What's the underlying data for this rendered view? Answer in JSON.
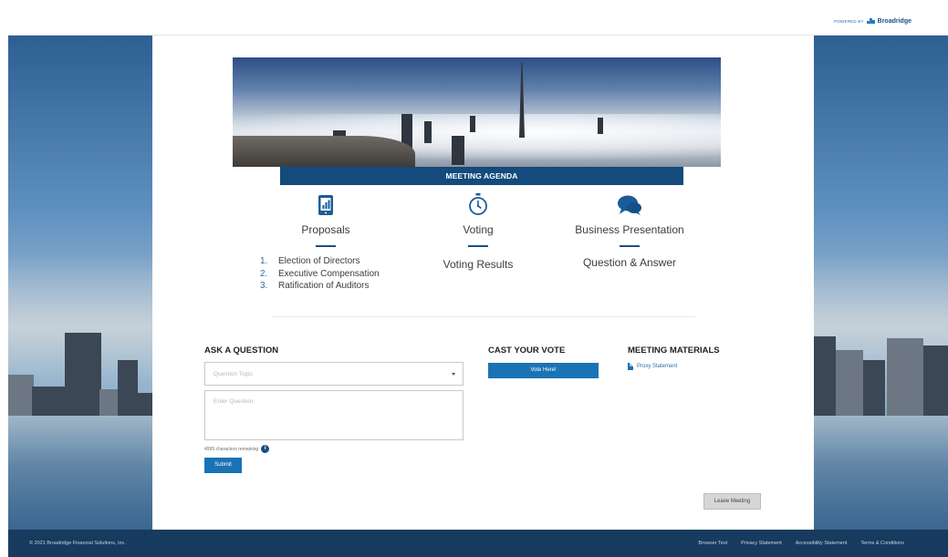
{
  "header": {
    "powered_by": "POWERED BY",
    "brand": "Broadridge"
  },
  "hero": {
    "agenda_title": "MEETING AGENDA"
  },
  "agenda": {
    "proposals": {
      "title": "Proposals",
      "icon": "tablet-chart-icon",
      "items": [
        {
          "num": "1.",
          "label": "Election of Directors"
        },
        {
          "num": "2.",
          "label": "Executive Compensation"
        },
        {
          "num": "3.",
          "label": "Ratification of Auditors"
        }
      ]
    },
    "voting": {
      "title": "Voting",
      "icon": "stopwatch-icon",
      "sub": "Voting Results"
    },
    "business": {
      "title": "Business Presentation",
      "icon": "chat-bubbles-icon",
      "sub": "Question & Answer"
    }
  },
  "ask": {
    "heading": "ASK A QUESTION",
    "select_placeholder": "Question Topic",
    "textarea_placeholder": "Enter Question",
    "remaining": "4995 characters remaining",
    "info": "i",
    "submit": "Submit"
  },
  "vote": {
    "heading": "CAST YOUR VOTE",
    "button": "Vote Here!"
  },
  "materials": {
    "heading": "MEETING MATERIALS",
    "proxy": "Proxy Statement"
  },
  "leave": "Leave Meeting",
  "footer": {
    "copyright": "© 2021 Broadridge Financial Solutions, Inc.",
    "links": [
      "Browser Test",
      "Privacy Statement",
      "Accessibility Statement",
      "Terms & Conditions"
    ]
  },
  "colors": {
    "navy": "#144a7c",
    "button_blue": "#1a73b5",
    "footer": "#173b5f"
  }
}
